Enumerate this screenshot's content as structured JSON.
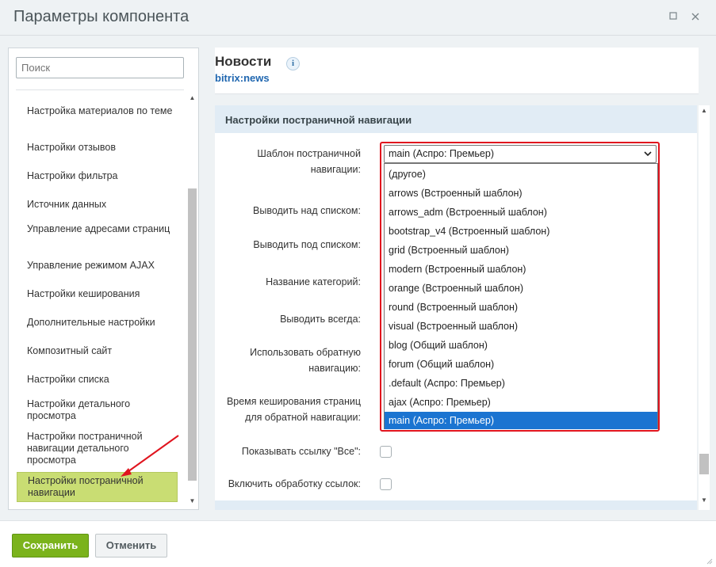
{
  "window": {
    "title": "Параметры компонента",
    "maximize_icon": "square-icon",
    "close_icon": "x-icon"
  },
  "sidebar": {
    "search_placeholder": "Поиск",
    "items": [
      {
        "label": "Настройка материалов по теме",
        "active": false
      },
      {
        "label": "Настройки отзывов",
        "active": false
      },
      {
        "label": "Настройки фильтра",
        "active": false
      },
      {
        "label": "Источник данных",
        "active": false
      },
      {
        "label": "Управление адресами страниц",
        "active": false
      },
      {
        "label": "Управление режимом AJAX",
        "active": false
      },
      {
        "label": "Настройки кеширования",
        "active": false
      },
      {
        "label": "Дополнительные настройки",
        "active": false
      },
      {
        "label": "Композитный сайт",
        "active": false
      },
      {
        "label": "Настройки списка",
        "active": false
      },
      {
        "label": "Настройки детального просмотра",
        "active": false
      },
      {
        "label": "Настройки постраничной навигации детального просмотра",
        "active": false
      },
      {
        "label": "Настройки постраничной навигации",
        "active": true
      }
    ]
  },
  "component": {
    "title": "Новости",
    "code": "bitrix:news"
  },
  "section": {
    "title": "Настройки постраничной навигации"
  },
  "fields": {
    "pager_template_label": "Шаблон постраничной навигации:",
    "display_top_label": "Выводить над списком:",
    "display_bottom_label": "Выводить под списком:",
    "pager_title_label": "Название категорий:",
    "show_always_label": "Выводить всегда:",
    "desc_numbering_label": "Использовать обратную навигацию:",
    "desc_cache_label": "Время кеширования страниц для обратной навигации:",
    "show_all_label": "Показывать ссылку \"Все\":",
    "base_link_label": "Включить обработку ссылок:"
  },
  "pager_select": {
    "value": "main (Аспро: Премьер)",
    "options": [
      {
        "label": "(другое)",
        "selected": false
      },
      {
        "label": "arrows (Встроенный шаблон)",
        "selected": false
      },
      {
        "label": "arrows_adm (Встроенный шаблон)",
        "selected": false
      },
      {
        "label": "bootstrap_v4 (Встроенный шаблон)",
        "selected": false
      },
      {
        "label": "grid (Встроенный шаблон)",
        "selected": false
      },
      {
        "label": "modern (Встроенный шаблон)",
        "selected": false
      },
      {
        "label": "orange (Встроенный шаблон)",
        "selected": false
      },
      {
        "label": "round (Встроенный шаблон)",
        "selected": false
      },
      {
        "label": "visual (Встроенный шаблон)",
        "selected": false
      },
      {
        "label": "blog (Общий шаблон)",
        "selected": false
      },
      {
        "label": "forum (Общий шаблон)",
        "selected": false
      },
      {
        "label": ".default (Аспро: Премьер)",
        "selected": false
      },
      {
        "label": "ajax (Аспро: Премьер)",
        "selected": false
      },
      {
        "label": "main (Аспро: Премьер)",
        "selected": true
      }
    ]
  },
  "footer": {
    "save_label": "Сохранить",
    "cancel_label": "Отменить"
  },
  "colors": {
    "save_button": "#7bb31c",
    "active_nav": "#c9dd73",
    "selected_option": "#1b74d1",
    "highlight_border": "#e0141e",
    "link": "#2067b0"
  }
}
